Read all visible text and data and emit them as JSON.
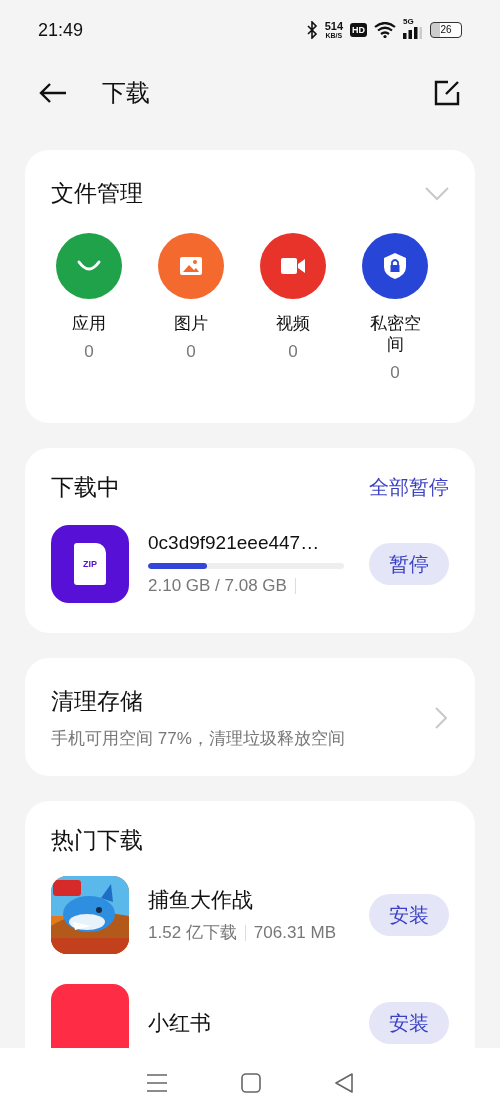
{
  "status_bar": {
    "time": "21:49",
    "net_speed": "514",
    "net_speed_unit": "KB/S",
    "hd_badge": "HD",
    "network": "5G",
    "battery": "26"
  },
  "header": {
    "title": "下载"
  },
  "file_management": {
    "title": "文件管理",
    "categories": [
      {
        "label": "应用",
        "count": "0",
        "kind": "apps",
        "color": "#1fa24a"
      },
      {
        "label": "图片",
        "count": "0",
        "kind": "images",
        "color": "#f4692d"
      },
      {
        "label": "视频",
        "count": "0",
        "kind": "videos",
        "color": "#e8332a"
      },
      {
        "label": "私密空间",
        "count": "0",
        "kind": "private",
        "color": "#2745d6"
      }
    ]
  },
  "downloading": {
    "title": "下载中",
    "action": "全部暂停",
    "items": [
      {
        "name": "0c3d9f921eee447…",
        "file_type": "ZIP",
        "level": 0.3,
        "progress": "2.10 GB / 7.08 GB",
        "button": "暂停"
      }
    ]
  },
  "cleanup": {
    "title": "清理存储",
    "subtitle": "手机可用空间 77%，清理垃圾释放空间"
  },
  "popular": {
    "title": "热门下载",
    "apps": [
      {
        "name": "捕鱼大作战",
        "kind": "picture",
        "downloads": "1.52 亿下载",
        "size": "706.31 MB",
        "button": "安装"
      },
      {
        "name": "小红书",
        "kind": "red-logo",
        "button": "安装"
      }
    ]
  }
}
